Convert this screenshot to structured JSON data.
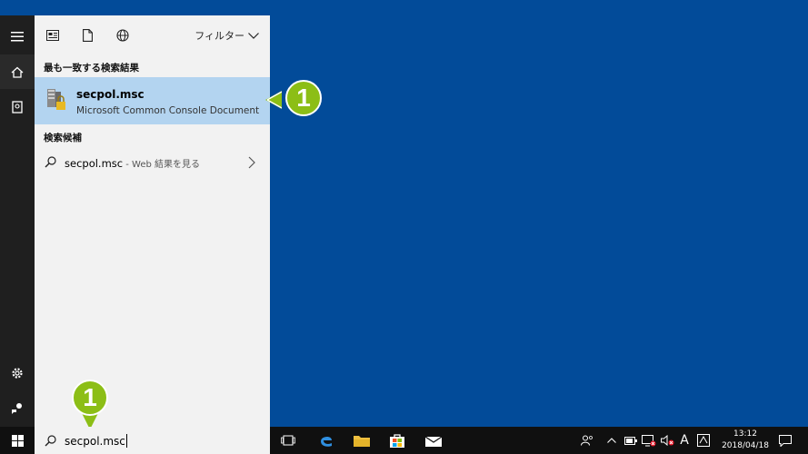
{
  "toolbar": {
    "filter_label": "フィルター"
  },
  "best_match": {
    "heading": "最も一致する検索結果",
    "title": "secpol.msc",
    "subtitle": "Microsoft Common Console Document"
  },
  "suggestions": {
    "heading": "検索候補",
    "items": [
      {
        "query": "secpol.msc",
        "suffix": " - Web 結果を見る"
      }
    ]
  },
  "callouts": {
    "result_badge": "1",
    "search_badge": "1"
  },
  "searchbox": {
    "value": "secpol.msc"
  },
  "clock": {
    "time": "13:12",
    "date": "2018/04/18"
  },
  "tray": {
    "ime": "A"
  },
  "colors": {
    "desktop": "#024b99",
    "panel": "#f2f2f2",
    "highlight": "#b3d4f0",
    "badge": "#8cbe16"
  }
}
